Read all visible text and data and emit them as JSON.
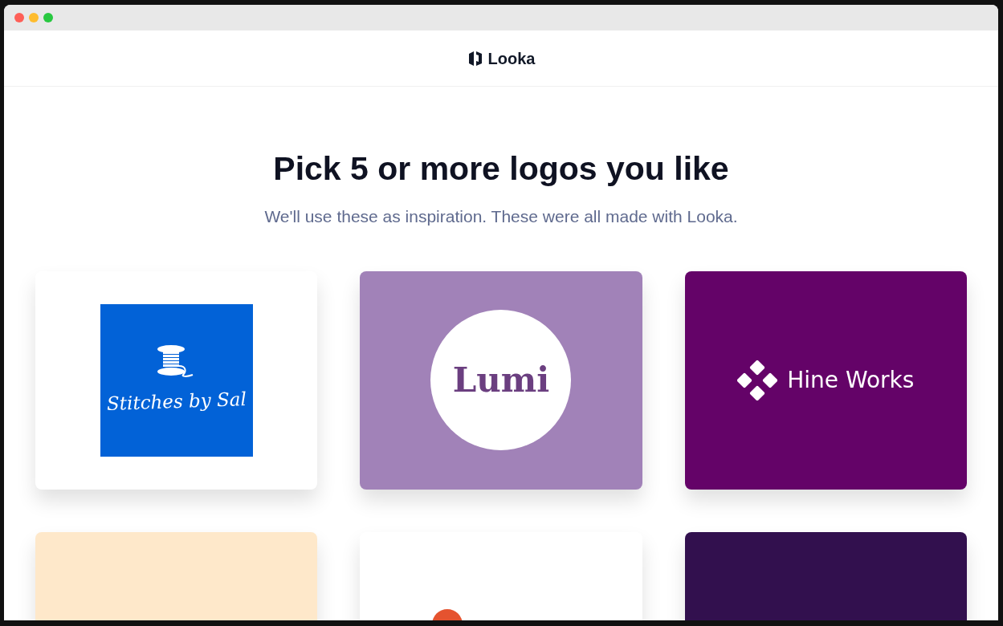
{
  "header": {
    "brand": "Looka"
  },
  "heading": "Pick 5 or more logos you like",
  "subtitle": "We'll use these as inspiration. These were all made with Looka.",
  "logos": [
    {
      "kind": "spool",
      "name": "Stitches by Sal",
      "color": "#ffffff"
    },
    {
      "kind": "circle",
      "name": "Lumi",
      "color": "#a182b8"
    },
    {
      "kind": "diamonds",
      "name": "Hine Works",
      "color": "#640368"
    },
    {
      "kind": "plain",
      "color": "#fee8ca"
    },
    {
      "kind": "dot",
      "color": "#ffffff"
    },
    {
      "kind": "plain",
      "color": "#32104e"
    }
  ]
}
